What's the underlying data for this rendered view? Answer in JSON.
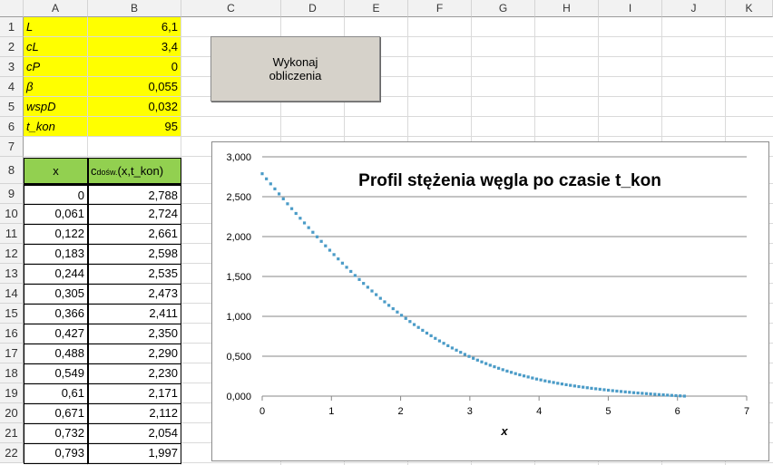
{
  "columns": [
    "A",
    "B",
    "C",
    "D",
    "E",
    "F",
    "G",
    "H",
    "I",
    "J",
    "K"
  ],
  "rows": [
    "1",
    "2",
    "3",
    "4",
    "5",
    "6",
    "7",
    "8",
    "9",
    "10",
    "11",
    "12",
    "13",
    "14",
    "15",
    "16",
    "17",
    "18",
    "19",
    "20",
    "21",
    "22"
  ],
  "params": [
    {
      "label": "L",
      "value": "6,1"
    },
    {
      "label": "cL",
      "value": "3,4"
    },
    {
      "label": "cP",
      "value": "0"
    },
    {
      "label": "β",
      "value": "0,055"
    },
    {
      "label": "wspD",
      "value": "0,032"
    },
    {
      "label": "t_kon",
      "value": "95"
    }
  ],
  "table": {
    "header_x": "x",
    "header_c_main": "c",
    "header_c_sub": "dośw.",
    "header_c_rest": "(x,t_kon)",
    "rows": [
      {
        "x": "0",
        "c": "2,788"
      },
      {
        "x": "0,061",
        "c": "2,724"
      },
      {
        "x": "0,122",
        "c": "2,661"
      },
      {
        "x": "0,183",
        "c": "2,598"
      },
      {
        "x": "0,244",
        "c": "2,535"
      },
      {
        "x": "0,305",
        "c": "2,473"
      },
      {
        "x": "0,366",
        "c": "2,411"
      },
      {
        "x": "0,427",
        "c": "2,350"
      },
      {
        "x": "0,488",
        "c": "2,290"
      },
      {
        "x": "0,549",
        "c": "2,230"
      },
      {
        "x": "0,61",
        "c": "2,171"
      },
      {
        "x": "0,671",
        "c": "2,112"
      },
      {
        "x": "0,732",
        "c": "2,054"
      },
      {
        "x": "0,793",
        "c": "1,997"
      }
    ]
  },
  "button": {
    "line1": "Wykonaj",
    "line2": "obliczenia"
  },
  "chart_data": {
    "type": "scatter",
    "title": "Profil stężenia węgla po czasie t_kon",
    "xlabel": "x",
    "ylabel": "",
    "xlim": [
      0,
      7
    ],
    "ylim": [
      0,
      3
    ],
    "xticks": [
      "0",
      "1",
      "2",
      "3",
      "4",
      "5",
      "6",
      "7"
    ],
    "yticks": [
      "0,000",
      "0,500",
      "1,000",
      "1,500",
      "2,000",
      "2,500",
      "3,000"
    ],
    "grid": "horizontal",
    "legend": "none",
    "series_color": "#4a9bc7",
    "x": [
      0,
      0.061,
      0.122,
      0.183,
      0.244,
      0.305,
      0.366,
      0.427,
      0.488,
      0.549,
      0.61,
      0.671,
      0.732,
      0.793,
      0.854,
      0.915,
      0.976,
      1.037,
      1.098,
      1.159,
      1.22,
      1.281,
      1.342,
      1.403,
      1.464,
      1.525,
      1.586,
      1.647,
      1.708,
      1.769,
      1.83,
      1.891,
      1.952,
      2.013,
      2.074,
      2.135,
      2.196,
      2.257,
      2.318,
      2.379,
      2.44,
      2.501,
      2.562,
      2.623,
      2.684,
      2.745,
      2.806,
      2.867,
      2.928,
      2.989,
      3.05,
      3.111,
      3.172,
      3.233,
      3.294,
      3.355,
      3.416,
      3.477,
      3.538,
      3.599,
      3.66,
      3.721,
      3.782,
      3.843,
      3.904,
      3.965,
      4.026,
      4.087,
      4.148,
      4.209,
      4.27,
      4.331,
      4.392,
      4.453,
      4.514,
      4.575,
      4.636,
      4.697,
      4.758,
      4.819,
      4.88,
      4.941,
      5.002,
      5.063,
      5.124,
      5.185,
      5.246,
      5.307,
      5.368,
      5.429,
      5.49,
      5.551,
      5.612,
      5.673,
      5.734,
      5.795,
      5.856,
      5.917,
      5.978,
      6.039,
      6.1
    ],
    "y": [
      2.788,
      2.724,
      2.661,
      2.598,
      2.535,
      2.473,
      2.411,
      2.35,
      2.29,
      2.23,
      2.171,
      2.112,
      2.054,
      1.997,
      1.94,
      1.884,
      1.829,
      1.774,
      1.72,
      1.667,
      1.615,
      1.563,
      1.512,
      1.462,
      1.413,
      1.365,
      1.318,
      1.272,
      1.226,
      1.182,
      1.138,
      1.096,
      1.054,
      1.013,
      0.974,
      0.935,
      0.897,
      0.861,
      0.825,
      0.79,
      0.757,
      0.724,
      0.692,
      0.662,
      0.632,
      0.603,
      0.576,
      0.549,
      0.523,
      0.498,
      0.474,
      0.451,
      0.429,
      0.408,
      0.387,
      0.368,
      0.349,
      0.331,
      0.314,
      0.298,
      0.282,
      0.267,
      0.253,
      0.24,
      0.227,
      0.214,
      0.203,
      0.191,
      0.181,
      0.171,
      0.161,
      0.152,
      0.143,
      0.135,
      0.127,
      0.119,
      0.112,
      0.105,
      0.098,
      0.092,
      0.086,
      0.08,
      0.074,
      0.068,
      0.063,
      0.058,
      0.053,
      0.048,
      0.043,
      0.039,
      0.035,
      0.031,
      0.027,
      0.023,
      0.019,
      0.016,
      0.012,
      0.009,
      0.006,
      0.003,
      0
    ]
  }
}
